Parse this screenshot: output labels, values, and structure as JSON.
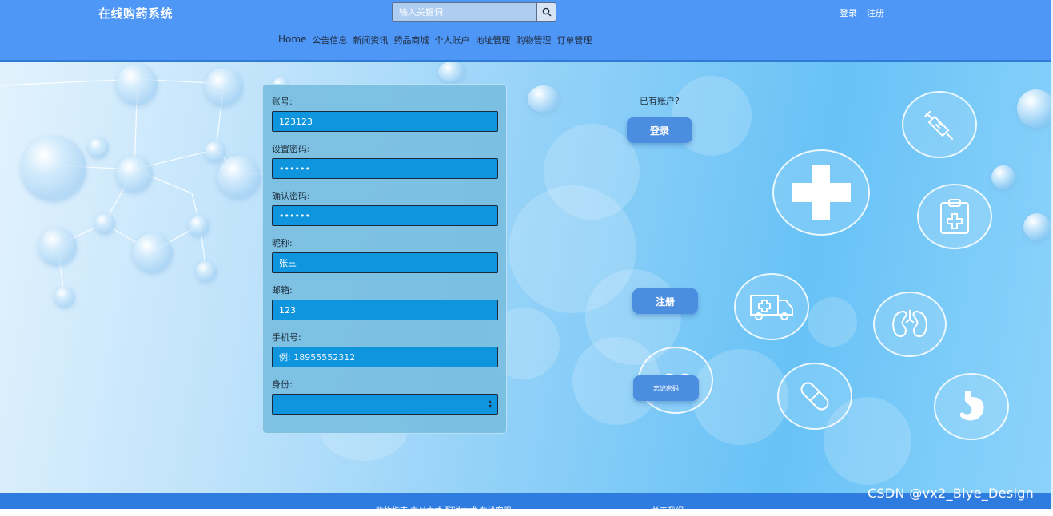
{
  "header": {
    "brand": "在线购药系统",
    "search": {
      "placeholder": "输入关键词",
      "button_icon": "search-icon"
    },
    "top_links": [
      {
        "label": "登录"
      },
      {
        "label": "注册"
      }
    ],
    "nav": [
      {
        "label": "Home"
      },
      {
        "label": "公告信息"
      },
      {
        "label": "新闻资讯"
      },
      {
        "label": "药品商城"
      },
      {
        "label": "个人账户"
      },
      {
        "label": "地址管理"
      },
      {
        "label": "购物管理"
      },
      {
        "label": "订单管理"
      }
    ]
  },
  "form": {
    "fields": [
      {
        "label": "账号:",
        "value": "123123",
        "type": "text"
      },
      {
        "label": "设置密码:",
        "value": "••••••",
        "type": "password"
      },
      {
        "label": "确认密码:",
        "value": "••••••",
        "type": "password"
      },
      {
        "label": "昵称:",
        "value": "张三",
        "type": "text"
      },
      {
        "label": "邮箱:",
        "value": "123",
        "type": "text"
      },
      {
        "label": "手机号:",
        "value": "",
        "placeholder": "例: 18955552312",
        "type": "text"
      }
    ],
    "role": {
      "label": "身份:",
      "value": ""
    }
  },
  "side": {
    "already_text": "已有账户?",
    "login_label": "登录",
    "register_label": "注册",
    "forgot_label": "忘记密码"
  },
  "footer": {
    "left_text": "购物指南 支付方式 配送方式 在线客服",
    "right_text": "关于我们"
  },
  "watermark": "CSDN @vx2_Biye_Design",
  "colors": {
    "header_bg": "#4e97f7",
    "input_bg": "#0e95de",
    "button_bg": "#4b8ee0",
    "footer_bg": "#2f7ce0"
  },
  "icons": [
    "search-icon",
    "syringe-icon",
    "medical-cross-icon",
    "clipboard-icon",
    "ambulance-icon",
    "kidney-icon",
    "pill-icon",
    "stomach-icon",
    "cloud-icon"
  ]
}
